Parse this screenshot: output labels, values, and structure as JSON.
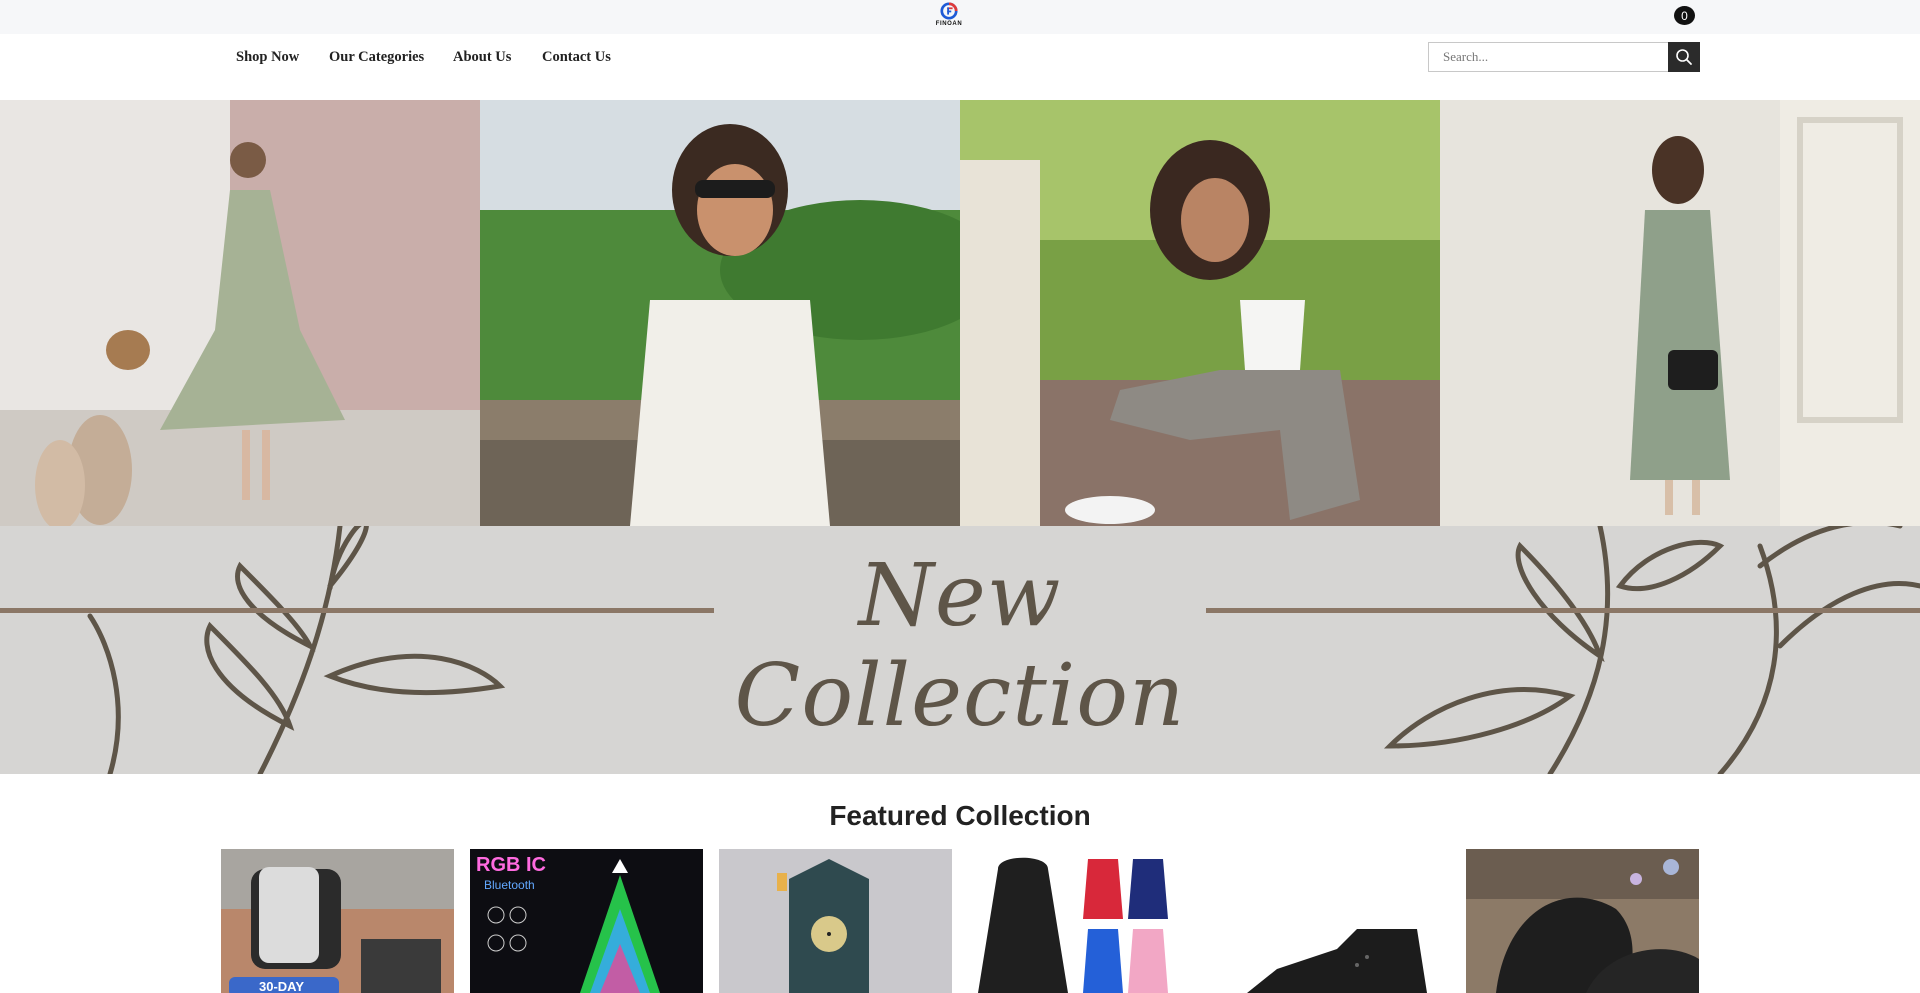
{
  "brand": {
    "name": "FINOAN",
    "logo_colors": [
      "#e03a3a",
      "#1f5bd6"
    ]
  },
  "header": {
    "cart_count": "0",
    "cart_icon": "shopping-bag-icon"
  },
  "nav": {
    "items": [
      {
        "label": "Shop Now"
      },
      {
        "label": "Our Categories"
      },
      {
        "label": "About Us"
      },
      {
        "label": "Contact Us"
      }
    ]
  },
  "search": {
    "placeholder": "Search...",
    "value": "",
    "icon": "search-icon"
  },
  "hero": {
    "images": [
      {
        "subject": "woman in sage green dress with wicker basket"
      },
      {
        "subject": "smiling woman in sunglasses and white sleeveless top"
      },
      {
        "subject": "woman in white crop top and grey wide-leg trousers"
      },
      {
        "subject": "woman in green dress holding black handbag"
      }
    ]
  },
  "banner": {
    "title": "New Collection"
  },
  "featured": {
    "title": "Featured Collection",
    "products": [
      {
        "subject": "car phone holder",
        "badge": "30-DAY"
      },
      {
        "subject": "RGB IC bluetooth christmas tree lights",
        "text_top": "RGB IC",
        "text_sub": "Bluetooth"
      },
      {
        "subject": "haunted cuckoo clock"
      },
      {
        "subject": "women's rain jackets"
      },
      {
        "subject": "black high-top sneaker"
      },
      {
        "subject": "black platform loafers"
      }
    ]
  },
  "colors": {
    "topbar_bg": "#f6f7f9",
    "banner_bg": "#d6d5d3",
    "accent_dark": "#2b2b2b",
    "banner_text": "#5e5548"
  }
}
